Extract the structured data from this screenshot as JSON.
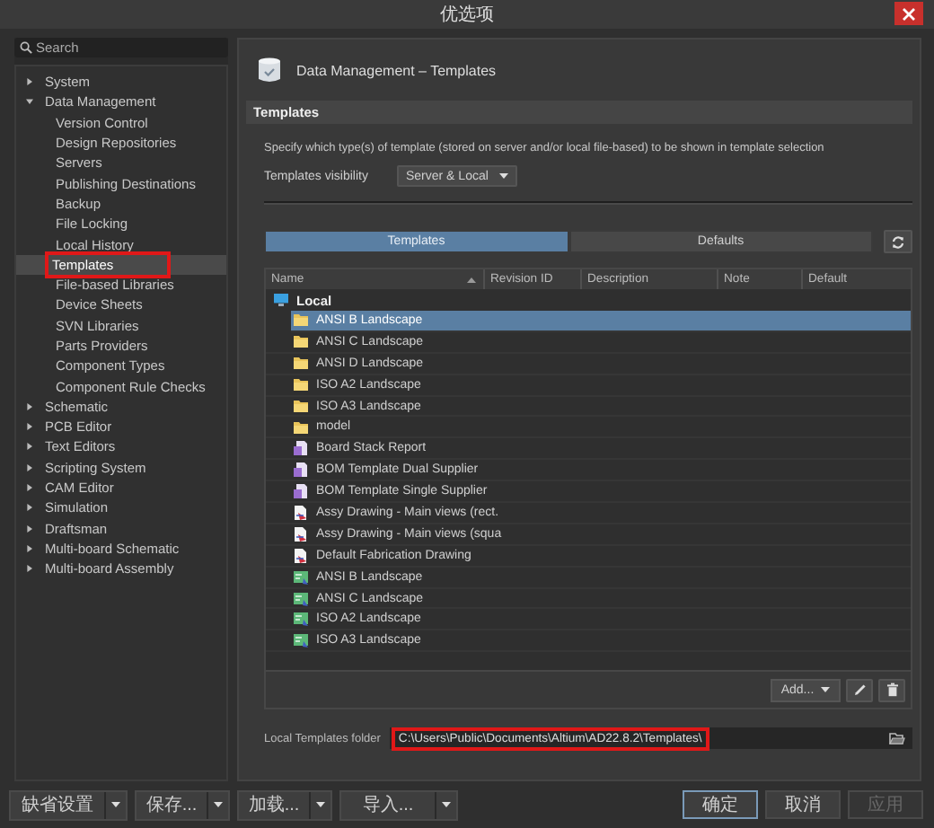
{
  "window": {
    "title": "优选项"
  },
  "search": {
    "placeholder": "Search"
  },
  "tree": [
    {
      "label": "System",
      "expanded": false,
      "selected": false
    },
    {
      "label": "Data Management",
      "expanded": true,
      "selected": false,
      "children": [
        {
          "label": "Version Control",
          "selected": false,
          "highlighted": false
        },
        {
          "label": "Design Repositories",
          "selected": false,
          "highlighted": false
        },
        {
          "label": "Servers",
          "selected": false,
          "highlighted": false
        },
        {
          "label": "Publishing Destinations",
          "selected": false,
          "highlighted": false
        },
        {
          "label": "Backup",
          "selected": false,
          "highlighted": false
        },
        {
          "label": "File Locking",
          "selected": false,
          "highlighted": false
        },
        {
          "label": "Local History",
          "selected": false,
          "highlighted": false
        },
        {
          "label": "Templates",
          "selected": true,
          "highlighted": true
        },
        {
          "label": "File-based Libraries",
          "selected": false,
          "highlighted": false
        },
        {
          "label": "Device Sheets",
          "selected": false,
          "highlighted": false
        },
        {
          "label": "SVN Libraries",
          "selected": false,
          "highlighted": false
        },
        {
          "label": "Parts Providers",
          "selected": false,
          "highlighted": false
        },
        {
          "label": "Component Types",
          "selected": false,
          "highlighted": false
        },
        {
          "label": "Component Rule Checks",
          "selected": false,
          "highlighted": false
        }
      ]
    },
    {
      "label": "Schematic",
      "expanded": false,
      "selected": false
    },
    {
      "label": "PCB Editor",
      "expanded": false,
      "selected": false
    },
    {
      "label": "Text Editors",
      "expanded": false,
      "selected": false
    },
    {
      "label": "Scripting System",
      "expanded": false,
      "selected": false
    },
    {
      "label": "CAM Editor",
      "expanded": false,
      "selected": false
    },
    {
      "label": "Simulation",
      "expanded": false,
      "selected": false
    },
    {
      "label": "Draftsman",
      "expanded": false,
      "selected": false
    },
    {
      "label": "Multi-board Schematic",
      "expanded": false,
      "selected": false
    },
    {
      "label": "Multi-board Assembly",
      "expanded": false,
      "selected": false
    }
  ],
  "page": {
    "title": "Data Management – Templates"
  },
  "section": {
    "title": "Templates",
    "description": "Specify which type(s) of template (stored on server and/or local file-based) to be shown in template selection",
    "visibility_label": "Templates visibility",
    "visibility_value": "Server & Local"
  },
  "tabs": [
    {
      "label": "Templates",
      "selected": true
    },
    {
      "label": "Defaults",
      "selected": false
    }
  ],
  "table": {
    "columns": [
      "Name",
      "Revision ID",
      "Description",
      "Note",
      "Default"
    ],
    "root": {
      "label": "Local"
    },
    "rows": [
      {
        "kind": "folder",
        "name": "ANSI B Landscape",
        "selected": true
      },
      {
        "kind": "folder",
        "name": "ANSI C Landscape",
        "selected": false
      },
      {
        "kind": "folder",
        "name": "ANSI D Landscape",
        "selected": false
      },
      {
        "kind": "folder",
        "name": "ISO A2 Landscape",
        "selected": false
      },
      {
        "kind": "folder",
        "name": "ISO A3 Landscape",
        "selected": false
      },
      {
        "kind": "folder",
        "name": "model",
        "selected": false
      },
      {
        "kind": "report",
        "name": "Board Stack Report",
        "selected": false
      },
      {
        "kind": "report",
        "name": "BOM Template Dual Supplier",
        "selected": false
      },
      {
        "kind": "report",
        "name": "BOM Template Single Supplier",
        "selected": false
      },
      {
        "kind": "drawing",
        "name": "Assy Drawing - Main views (rect.",
        "selected": false
      },
      {
        "kind": "drawing",
        "name": "Assy Drawing - Main views (squa",
        "selected": false
      },
      {
        "kind": "drawing",
        "name": "Default Fabrication Drawing",
        "selected": false
      },
      {
        "kind": "sheet",
        "name": "ANSI B Landscape",
        "selected": false
      },
      {
        "kind": "sheet",
        "name": "ANSI C Landscape",
        "selected": false
      },
      {
        "kind": "sheet",
        "name": "ISO A2 Landscape",
        "selected": false
      },
      {
        "kind": "sheet",
        "name": "ISO A3 Landscape",
        "selected": false
      }
    ],
    "add_button": "Add..."
  },
  "folder": {
    "label": "Local Templates folder",
    "value": "C:\\Users\\Public\\Documents\\Altium\\AD22.8.2\\Templates\\",
    "highlighted": true
  },
  "footer": {
    "left": [
      {
        "label": "缺省设置"
      },
      {
        "label": "保存..."
      },
      {
        "label": "加载..."
      },
      {
        "label": "导入..."
      }
    ],
    "right": [
      {
        "label": "确定",
        "focused": true,
        "disabled": false
      },
      {
        "label": "取消",
        "focused": false,
        "disabled": false
      },
      {
        "label": "应用",
        "focused": false,
        "disabled": true
      }
    ]
  }
}
